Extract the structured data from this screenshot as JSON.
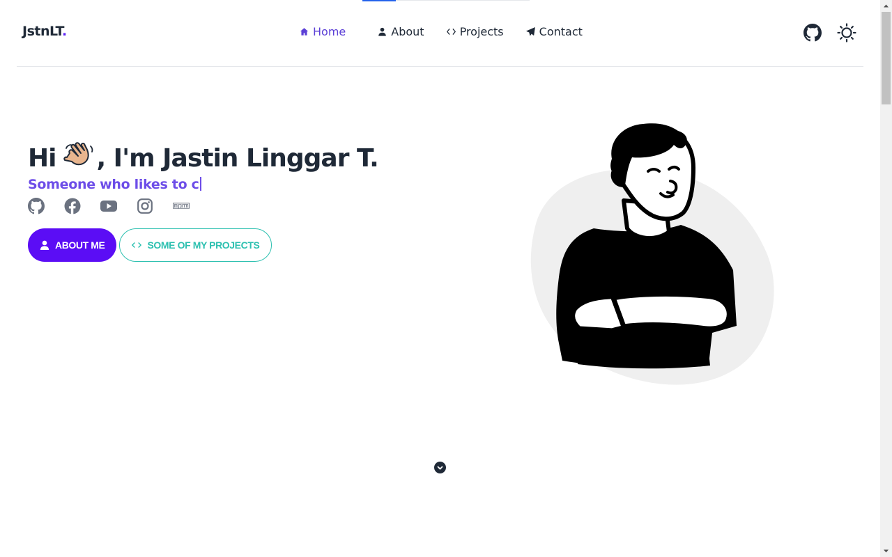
{
  "brand": {
    "name": "JstnLT",
    "dot": "."
  },
  "nav": {
    "items": [
      {
        "label": "Home",
        "icon": "home-icon",
        "active": true
      },
      {
        "label": "About",
        "icon": "user-icon",
        "active": false
      },
      {
        "label": "Projects",
        "icon": "code-icon",
        "active": false
      },
      {
        "label": "Contact",
        "icon": "paper-plane-icon",
        "active": false
      }
    ],
    "right_icons": [
      "github-icon",
      "sun-icon"
    ]
  },
  "hero": {
    "greeting": "Hi",
    "name": ", I'm Jastin Linggar T.",
    "typed_text": "Someone who likes to c",
    "socials": [
      "github-icon",
      "facebook-icon",
      "youtube-icon",
      "instagram-icon",
      "npm-icon"
    ],
    "buttons": {
      "about": "ABOUT ME",
      "projects": "SOME OF MY PROJECTS"
    }
  },
  "scroll_progress": 0.2,
  "colors": {
    "accent": "#5b0df5",
    "teal": "#2dc0b0",
    "subtitle": "#6d4de8",
    "text": "#1f2937"
  }
}
